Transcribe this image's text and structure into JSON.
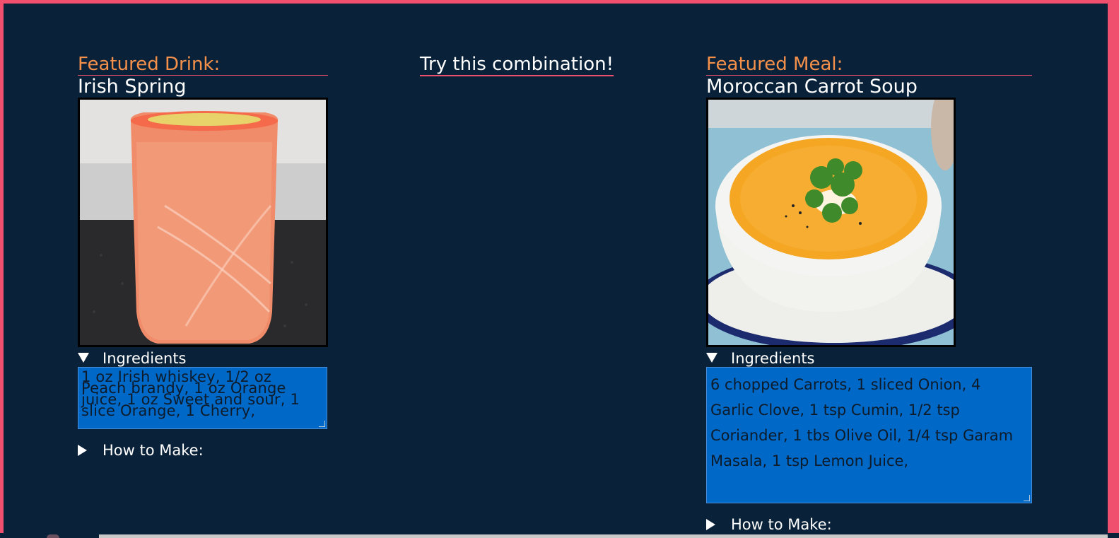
{
  "drink": {
    "heading": "Featured Drink:",
    "name": "Irish Spring",
    "image_alt": "Irish Spring",
    "ingredients_label": "Ingredients",
    "ingredients_lines": [
      " 1 oz  Irish whiskey,  1/2 oz",
      "Peach brandy,  1 oz  Orange",
      "juice,  1 oz  Sweet and sour,  1",
      "slice  Orange,  1  Cherry,"
    ],
    "how_to_label": "How to Make:"
  },
  "middle": {
    "title": "Try this combination!"
  },
  "meal": {
    "heading": "Featured Meal:",
    "name": "Moroccan Carrot Soup",
    "image_alt": "Moroccan Carrot Soup",
    "ingredients_label": "Ingredients",
    "ingredients_text": "6 chopped Carrots, 1 sliced Onion, 4 Garlic Clove, 1 tsp  Cumin, 1/2 tsp Coriander, 1 tbs Olive Oil, 1/4 tsp Garam Masala, 1 tsp Lemon Juice,",
    "how_to_label": "How to Make:"
  },
  "colors": {
    "background": "#0a2239",
    "accent": "#f0506e",
    "heading": "#f5904a",
    "ingredients_bg": "#0068c6"
  }
}
